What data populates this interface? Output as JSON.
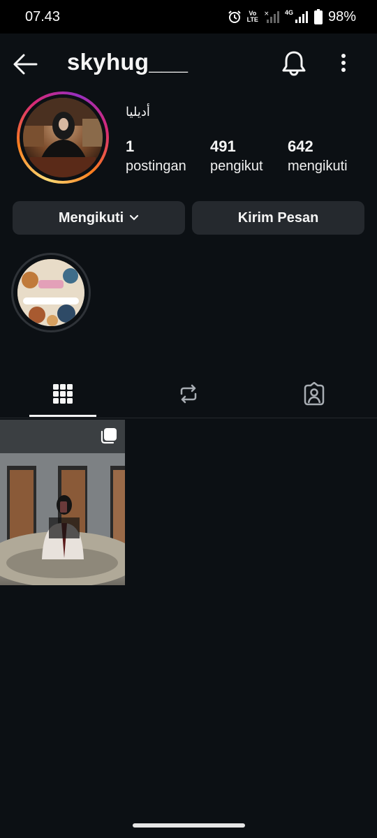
{
  "status_bar": {
    "time": "07.43",
    "volte_top": "Vo",
    "volte_bottom": "LTE",
    "network_type": "4G",
    "battery": "98%"
  },
  "header": {
    "username": "skyhug___"
  },
  "profile": {
    "full_name": "أديليا",
    "stats": [
      {
        "value": "1",
        "label": "postingan"
      },
      {
        "value": "491",
        "label": "pengikut"
      },
      {
        "value": "642",
        "label": "mengikuti"
      }
    ]
  },
  "actions": {
    "following_label": "Mengikuti",
    "message_label": "Kirim Pesan"
  },
  "icons": {
    "back": "arrow-left-icon",
    "notifications": "bell-icon",
    "more": "vertical-dots-icon",
    "grid_tab": "grid-icon",
    "reels_tab": "repost-icon",
    "tagged_tab": "tagged-person-icon",
    "multi_post": "carousel-icon"
  },
  "colors": {
    "background": "#0c1014",
    "button": "#25292e",
    "text": "#f5f5f5"
  }
}
